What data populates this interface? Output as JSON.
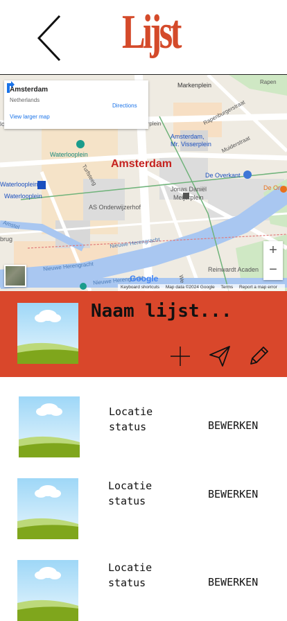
{
  "header": {
    "logo_text": "Lijst",
    "back_icon": "chevron-left-icon"
  },
  "map": {
    "info_card": {
      "title": "Amsterdam",
      "subtitle": "Netherlands",
      "link": "View larger map",
      "directions": "Directions"
    },
    "labels": {
      "city": "Amsterdam",
      "markenplein": "Markenplein",
      "rapenburg": "Rapenburgerstraat",
      "visserplein_top": "Mr. Visserplein",
      "visserplein_stop1": "Amsterdam,",
      "visserplein_stop2": "Mr. Visserplein",
      "muiderstraat": "Muiderstraat",
      "waterlooplein": "Waterlooplein",
      "waterlooplein_metro": "Waterlooplein",
      "waterlooplein_tram": "Waterlooplein",
      "turfsteeg": "Turfsteeg",
      "de_overkant": "De Overkant",
      "de_oranje": "De Oranj",
      "jonas1": "Jonas Daniël",
      "jonas2": "Meijerplein",
      "as_onderwijzer": "AS Onderwijzerhof",
      "herengracht1": "Nieuwe Herengracht",
      "herengracht2": "Nieuwe Herengracht",
      "herengracht3": "Nieuwe Herengracht",
      "reinwardt": "Reinwardt Acaden",
      "left_edge": "loopin",
      "amstel": "Amstel",
      "brug": "brug",
      "we": "We",
      "rapen": "Rapen"
    },
    "google": "Google",
    "attribution": [
      "Keyboard shortcuts",
      "Map data ©2024 Google",
      "Terms",
      "Report a map error"
    ],
    "zoom_in": "+",
    "zoom_out": "−"
  },
  "banner": {
    "title": "Naam lijst...",
    "actions": [
      "plus-icon",
      "send-icon",
      "pencil-icon"
    ]
  },
  "items": [
    {
      "line1": "Locatie",
      "line2": "status",
      "edit": "BEWERKEN"
    },
    {
      "line1": "Locatie",
      "line2": "status",
      "edit": "BEWERKEN"
    },
    {
      "line1": "Locatie",
      "line2": "status",
      "edit": "BEWERKEN"
    }
  ],
  "colors": {
    "accent": "#d9472b",
    "logo": "#d44a2a",
    "water": "#a9c7f1",
    "park": "#c8e6c0"
  }
}
